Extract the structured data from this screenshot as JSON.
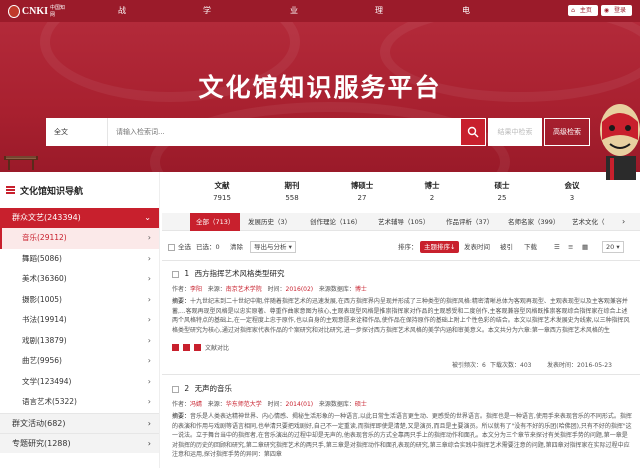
{
  "logo": {
    "name": "CNKI",
    "sub": "中国知网"
  },
  "nav": [
    "战略情报",
    "学习空间",
    "业内专家",
    "理论研究",
    "电子阅览"
  ],
  "top_right": [
    "主页",
    "登录"
  ],
  "banner": {
    "title": "文化馆知识服务平台"
  },
  "search": {
    "type": "全文",
    "placeholder": "请输入检索词...",
    "in_results": "结果中检索",
    "advanced": "高级检索"
  },
  "sidebar": {
    "title": "文化馆知识导航",
    "category": "群众文艺(243394)",
    "items": [
      "音乐(29112)",
      "舞蹈(5086)",
      "美术(36360)",
      "摄影(1005)",
      "书法(19914)",
      "戏剧(13879)",
      "曲艺(9956)",
      "文学(123494)",
      "语言艺术(5322)"
    ],
    "collapsed": [
      "群文活动(682)",
      "专题研究(1288)"
    ]
  },
  "stats": [
    {
      "label": "文献",
      "num": "7915"
    },
    {
      "label": "期刊",
      "num": "558"
    },
    {
      "label": "博硕士",
      "num": "27"
    },
    {
      "label": "博士",
      "num": "2"
    },
    {
      "label": "硕士",
      "num": "25"
    },
    {
      "label": "会议",
      "num": "3"
    }
  ],
  "tabs": [
    "全部（713）",
    "发展历史（3）",
    "创作理论（116）",
    "艺术辅导（105）",
    "作品评析（37）",
    "名师名家（399）",
    "艺术文化（"
  ],
  "toolbar": {
    "select_all": "全选",
    "selected": "已选：",
    "selected_count": "0",
    "clear": "清除",
    "export": "导出与分析",
    "sort_label": "排序：",
    "sort_active": "主题排序↓",
    "sort_options": [
      "发表时间",
      "被引",
      "下载"
    ],
    "page_size": "20"
  },
  "results": [
    {
      "index": "1",
      "title": "西方指挥艺术风格类型研究",
      "author_label": "作者：",
      "author": "李阳",
      "source_label": "来源：",
      "source": "南京艺术学院",
      "time_label": "时间：",
      "time": "2016(02)",
      "type_label": "来源数据库：",
      "type": "博士",
      "abstract_label": "摘要：",
      "abstract": "十九世纪末到二十世纪中期,伴随着指挥艺术的迅速发展,在西方指挥界内呈现并形成了三种类型的指挥风格:精密清晰总体为客观再现型、主观表现型以及主客观兼容并蓄,...客观再现型风格是以忠实原著、尊重作曲家意图为核心,主观表现型风格是推崇指挥家对作品的主观感受和二度创作,主客观兼容型风格既推崇客观综合指挥家在综合上述两个风格特点的基础上,在一定程度上忠于原作,也以自身的主观意愿来诠释作品,使作品在保持原作的基础上附上个性色彩的结合。本文以指挥艺术发展史为线索,以三种指挥风格类型研究为核心,通过对指挥家代表作品的个案研究和对比研究,进一步探讨西方指挥艺术风格的美学内涵和审美意义。本文共分为六章:第一章西方指挥艺术风格的生",
      "actions": [
        "下载",
        "阅读",
        "文献对比"
      ],
      "cited": "被引频次：",
      "cited_n": "6",
      "download": "下载次数：",
      "download_n": "403",
      "date_label": "发表时间：",
      "date": "2016-05-23"
    },
    {
      "index": "2",
      "title": "无声的音乐",
      "author_label": "作者：",
      "author": "冯婧",
      "source_label": "来源：",
      "source": "华东师范大学",
      "time_label": "时间：",
      "time": "2014(01)",
      "type_label": "来源数据库：",
      "type": "硕士",
      "abstract_label": "摘要：",
      "abstract": "音乐是人类表达精神世界、内心情感、揭秘生活形象的一种语言,以此日常生活语言更生动、更感受的世界语言。指挥也是一种语言,使用手来表现音乐的不同形式。指挥的表演和作用与戏剧等语言相同,也举清只要把戏剧好,自己不一定重读,而指挥即使是清楚,又是演员,而且是主要演员。所以就有了\"没有不好的乐团(哈佛团),只有不好的指挥\"这一说法。立于舞台当中的指挥者,在音乐演出的过程中却是无声的,他表现音乐的方式全靠两只手上的指挥动作和面孔。本文分为三个章节来探讨有关指挥手势的问题,第一章是对指挥的历史的回顾和研究,第二章研究指挥艺术的两只手,第三章是对指挥动作和面孔表现的研究,第三章综合实践中指挥艺术需要注意的问题,第四章对指挥家在实际过程中应注意和运用,探讨指挥手势的异同：第四章"
    }
  ]
}
